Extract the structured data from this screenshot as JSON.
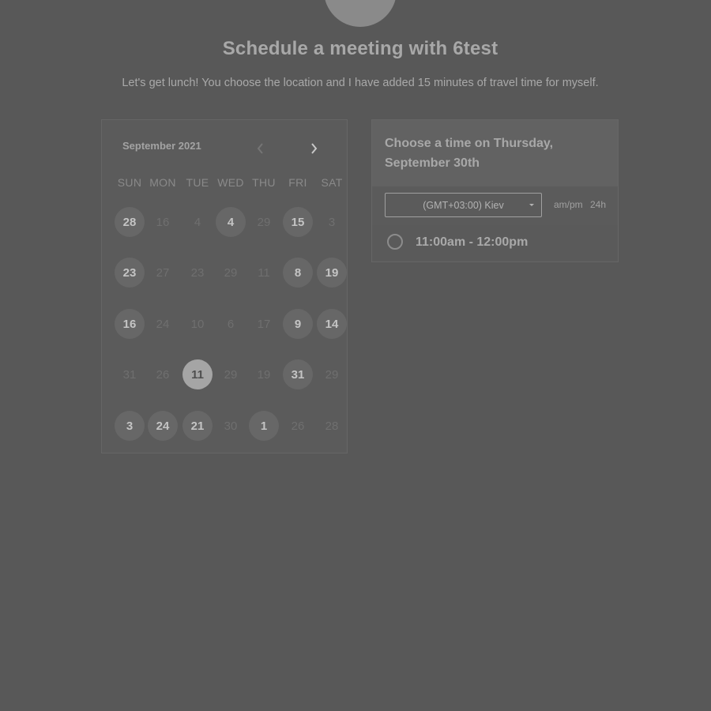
{
  "header": {
    "title": "Schedule a meeting with 6test",
    "subtitle": "Let's get lunch! You choose the location and I have added 15 minutes of travel time for myself."
  },
  "calendar": {
    "month_label": "September 2021",
    "prev_icon": "chevron-left-icon",
    "next_icon": "chevron-right-icon",
    "weekdays": [
      "SUN",
      "MON",
      "TUE",
      "WED",
      "THU",
      "FRI",
      "SAT"
    ],
    "weeks": [
      [
        {
          "d": "28",
          "s": "avail"
        },
        {
          "d": "16",
          "s": "off"
        },
        {
          "d": "4",
          "s": "off"
        },
        {
          "d": "4",
          "s": "avail"
        },
        {
          "d": "29",
          "s": "off"
        },
        {
          "d": "15",
          "s": "avail"
        },
        {
          "d": "3",
          "s": "off"
        }
      ],
      [
        {
          "d": "23",
          "s": "avail"
        },
        {
          "d": "27",
          "s": "off"
        },
        {
          "d": "23",
          "s": "off"
        },
        {
          "d": "29",
          "s": "off"
        },
        {
          "d": "11",
          "s": "off"
        },
        {
          "d": "8",
          "s": "avail"
        },
        {
          "d": "19",
          "s": "avail"
        }
      ],
      [
        {
          "d": "16",
          "s": "avail"
        },
        {
          "d": "24",
          "s": "off"
        },
        {
          "d": "10",
          "s": "off"
        },
        {
          "d": "6",
          "s": "off"
        },
        {
          "d": "17",
          "s": "off"
        },
        {
          "d": "9",
          "s": "avail"
        },
        {
          "d": "14",
          "s": "avail"
        }
      ],
      [
        {
          "d": "31",
          "s": "off"
        },
        {
          "d": "26",
          "s": "off"
        },
        {
          "d": "11",
          "s": "sel"
        },
        {
          "d": "29",
          "s": "off"
        },
        {
          "d": "19",
          "s": "off"
        },
        {
          "d": "31",
          "s": "avail"
        },
        {
          "d": "29",
          "s": "off"
        }
      ],
      [
        {
          "d": "3",
          "s": "avail"
        },
        {
          "d": "24",
          "s": "avail"
        },
        {
          "d": "21",
          "s": "avail"
        },
        {
          "d": "30",
          "s": "off"
        },
        {
          "d": "1",
          "s": "avail"
        },
        {
          "d": "26",
          "s": "off"
        },
        {
          "d": "28",
          "s": "off"
        }
      ]
    ]
  },
  "time_panel": {
    "heading": "Choose a time on Thursday, September 30th",
    "timezone": "(GMT+03:00) Kiev",
    "format_ampm": "am/pm",
    "format_24h": "24h",
    "slots": [
      "11:00am - 12:00pm"
    ]
  }
}
